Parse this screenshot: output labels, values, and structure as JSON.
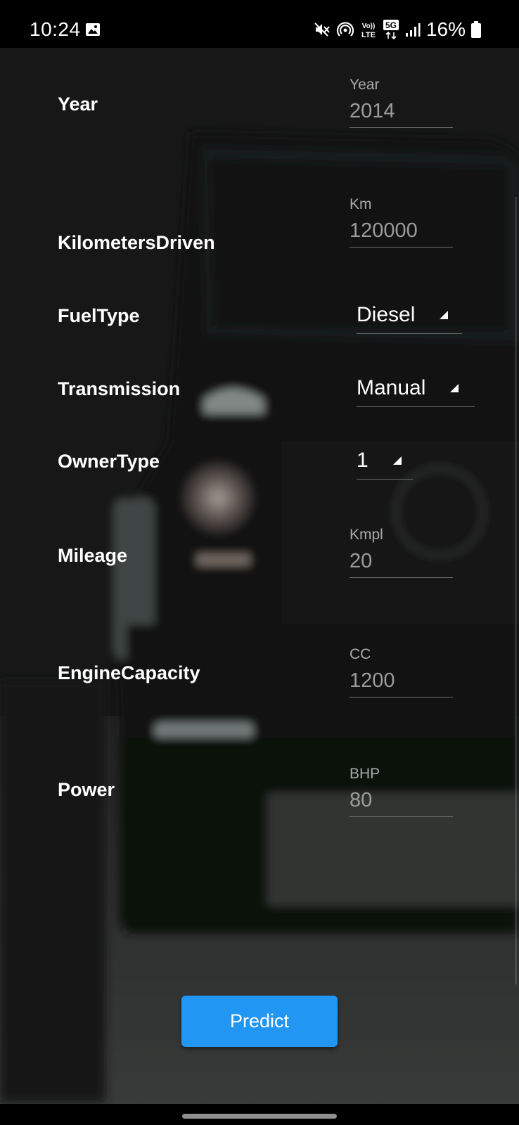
{
  "status_bar": {
    "time": "10:24",
    "network": "5G",
    "lte_top": "Vo))",
    "lte_bottom": "LTE",
    "battery": "16%",
    "icons": [
      "gallery-icon",
      "mute-icon",
      "hotspot-icon",
      "volte-icon",
      "5g-icon",
      "signal-icon",
      "battery-icon"
    ]
  },
  "form": {
    "year": {
      "label": "Year",
      "hint": "Year",
      "value": "2014"
    },
    "kilometers": {
      "label": "KilometersDriven",
      "hint": "Km",
      "value": "120000"
    },
    "fuel_type": {
      "label": "FuelType",
      "value": "Diesel"
    },
    "transmission": {
      "label": "Transmission",
      "value": "Manual"
    },
    "owner_type": {
      "label": "OwnerType",
      "value": "1"
    },
    "mileage": {
      "label": "Mileage",
      "hint": "Kmpl",
      "value": "20"
    },
    "engine": {
      "label": "EngineCapacity",
      "hint": "CC",
      "value": "1200"
    },
    "power": {
      "label": "Power",
      "hint": "BHP",
      "value": "80"
    }
  },
  "predict_button": {
    "label": "Predict",
    "color": "#2196f3"
  },
  "colors": {
    "background": "#1b1d1c",
    "label_text": "#ffffff",
    "input_text": "#9b9d9c",
    "hint_text": "#a8aaa9"
  }
}
